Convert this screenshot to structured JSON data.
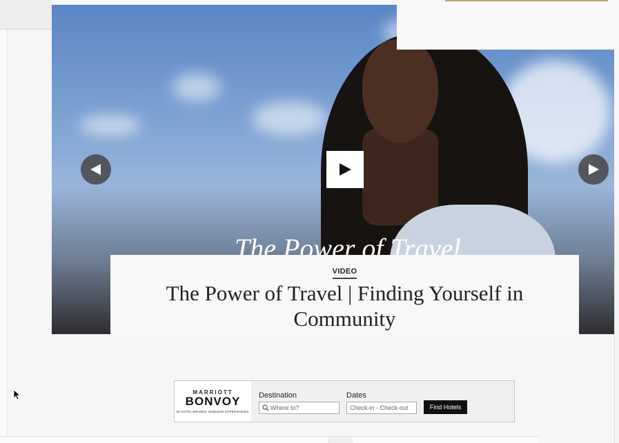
{
  "hero": {
    "overlay_text": "The Power of Travel",
    "prev_icon": "chevron-left-icon",
    "next_icon": "chevron-right-icon",
    "play_icon": "play-icon"
  },
  "caption": {
    "tag": "VIDEO",
    "title": "The Power of Travel | Finding Yourself in Community"
  },
  "booking": {
    "brand_top": "MARRIOTT",
    "brand_main": "BONVOY",
    "brand_tagline": "30 HOTEL BRANDS. ENDLESS EXPERIENCES.",
    "destination_label": "Destination",
    "destination_placeholder": "Where to?",
    "dates_label": "Dates",
    "dates_placeholder": "Check-in - Check-out",
    "find_button": "Find Hotels"
  },
  "colors": {
    "button_dark": "#111111",
    "arrow_bg": "#464646"
  }
}
